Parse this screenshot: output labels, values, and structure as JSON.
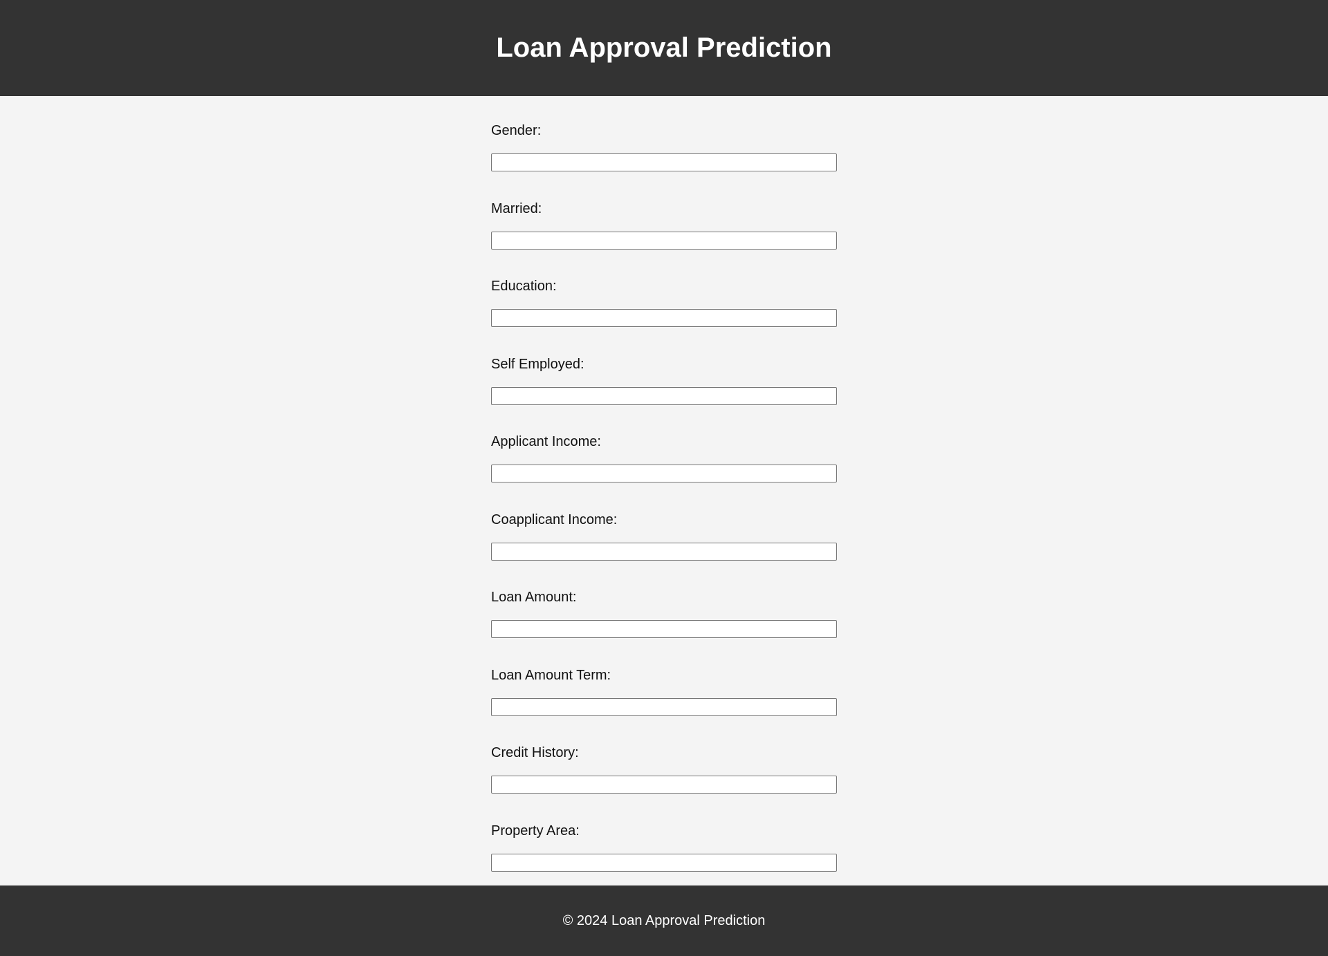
{
  "header": {
    "title": "Loan Approval Prediction"
  },
  "form": {
    "fields": [
      {
        "label": "Gender:",
        "value": "",
        "placeholder": ""
      },
      {
        "label": "Married:",
        "value": "",
        "placeholder": ""
      },
      {
        "label": "Education:",
        "value": "",
        "placeholder": ""
      },
      {
        "label": "Self Employed:",
        "value": "",
        "placeholder": ""
      },
      {
        "label": "Applicant Income:",
        "value": "",
        "placeholder": ""
      },
      {
        "label": "Coapplicant Income:",
        "value": "",
        "placeholder": ""
      },
      {
        "label": "Loan Amount:",
        "value": "",
        "placeholder": ""
      },
      {
        "label": "Loan Amount Term:",
        "value": "",
        "placeholder": ""
      },
      {
        "label": "Credit History:",
        "value": "",
        "placeholder": ""
      },
      {
        "label": "Property Area:",
        "value": "",
        "placeholder": ""
      }
    ]
  },
  "footer": {
    "text": "© 2024 Loan Approval Prediction"
  },
  "colors": {
    "header_bg": "#333333",
    "page_bg": "#f4f4f4",
    "footer_bg": "#333333",
    "header_text": "#ffffff"
  }
}
